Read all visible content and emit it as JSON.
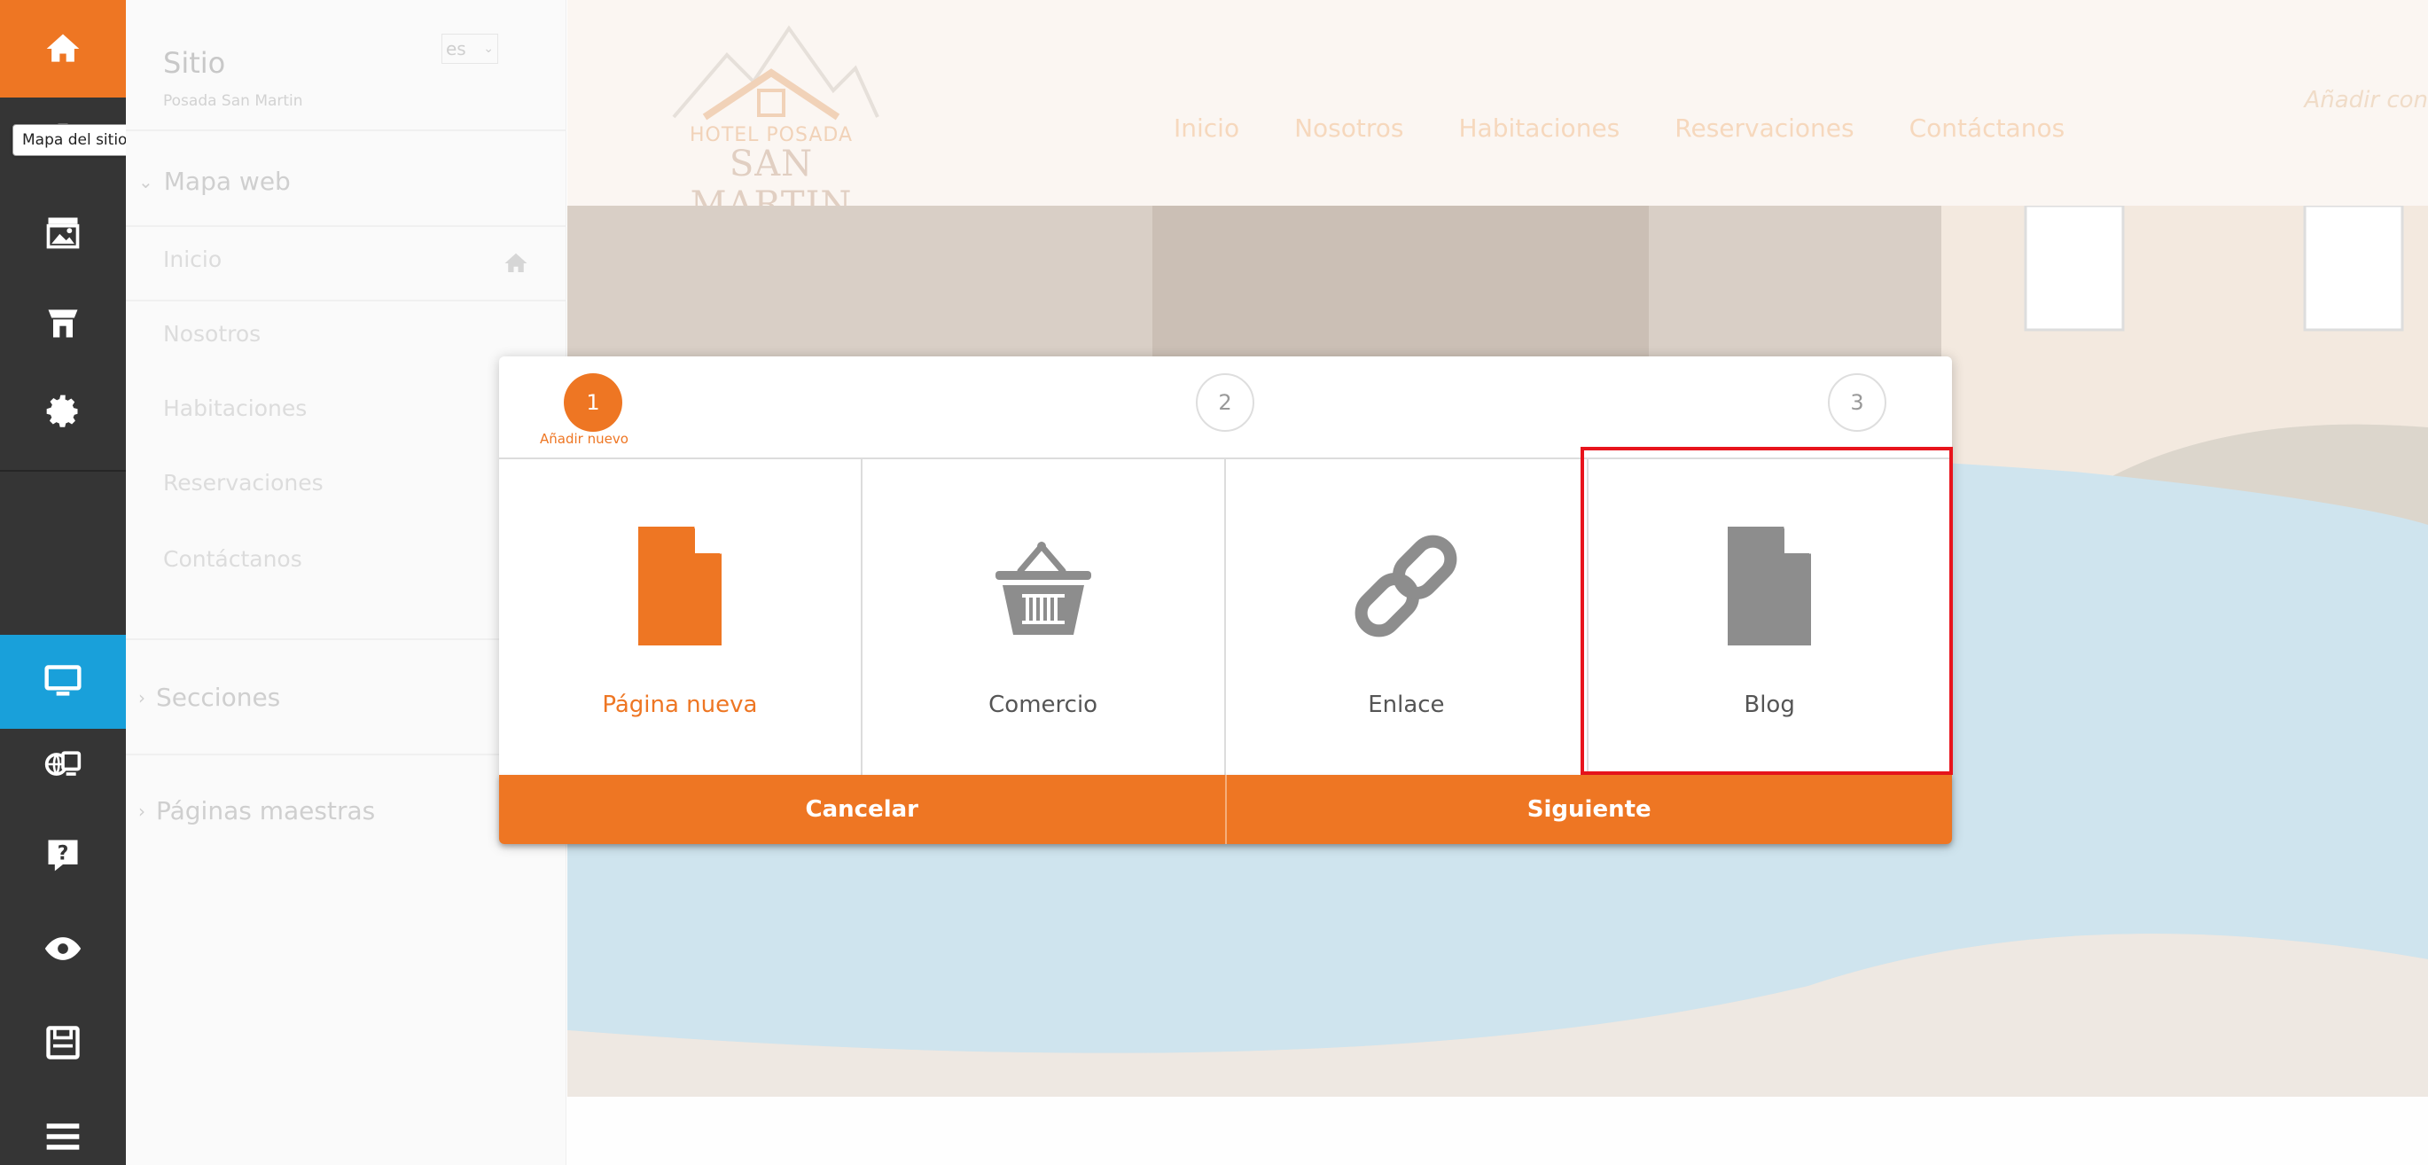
{
  "iconbar": {
    "tooltip": "Mapa del sitio",
    "icons": [
      "home-icon",
      "sitemap-icon",
      "gallery-icon",
      "store-icon",
      "gear-icon",
      "display-icon",
      "domain-icon",
      "help-icon",
      "eye-icon",
      "save-icon",
      "menu-icon"
    ]
  },
  "sitepanel": {
    "title": "Sitio",
    "subtitle": "Posada San Martin",
    "language": "es",
    "sitemap_label": "Mapa web",
    "pages": [
      "Inicio",
      "Nosotros",
      "Habitaciones",
      "Reservaciones",
      "Contáctanos"
    ],
    "sections_label": "Secciones",
    "masters_label": "Páginas maestras"
  },
  "preview": {
    "logo_line1": "HOTEL POSADA",
    "logo_line2": "SAN MARTIN",
    "nav": [
      "Inicio",
      "Nosotros",
      "Habitaciones",
      "Reservaciones",
      "Contáctanos"
    ],
    "add_content": "Añadir con"
  },
  "modal": {
    "steps": [
      "1",
      "2",
      "3"
    ],
    "step1_label": "Añadir nuevo",
    "options": [
      {
        "label": "Página nueva",
        "icon": "new-page-icon"
      },
      {
        "label": "Comercio",
        "icon": "basket-icon"
      },
      {
        "label": "Enlace",
        "icon": "link-icon"
      },
      {
        "label": "Blog",
        "icon": "blog-page-icon"
      }
    ],
    "cancel": "Cancelar",
    "next": "Siguiente"
  },
  "colors": {
    "accent": "#ee7623",
    "highlight": "#e8141c",
    "iconbar": "#353535",
    "active_blue": "#19a0da"
  }
}
